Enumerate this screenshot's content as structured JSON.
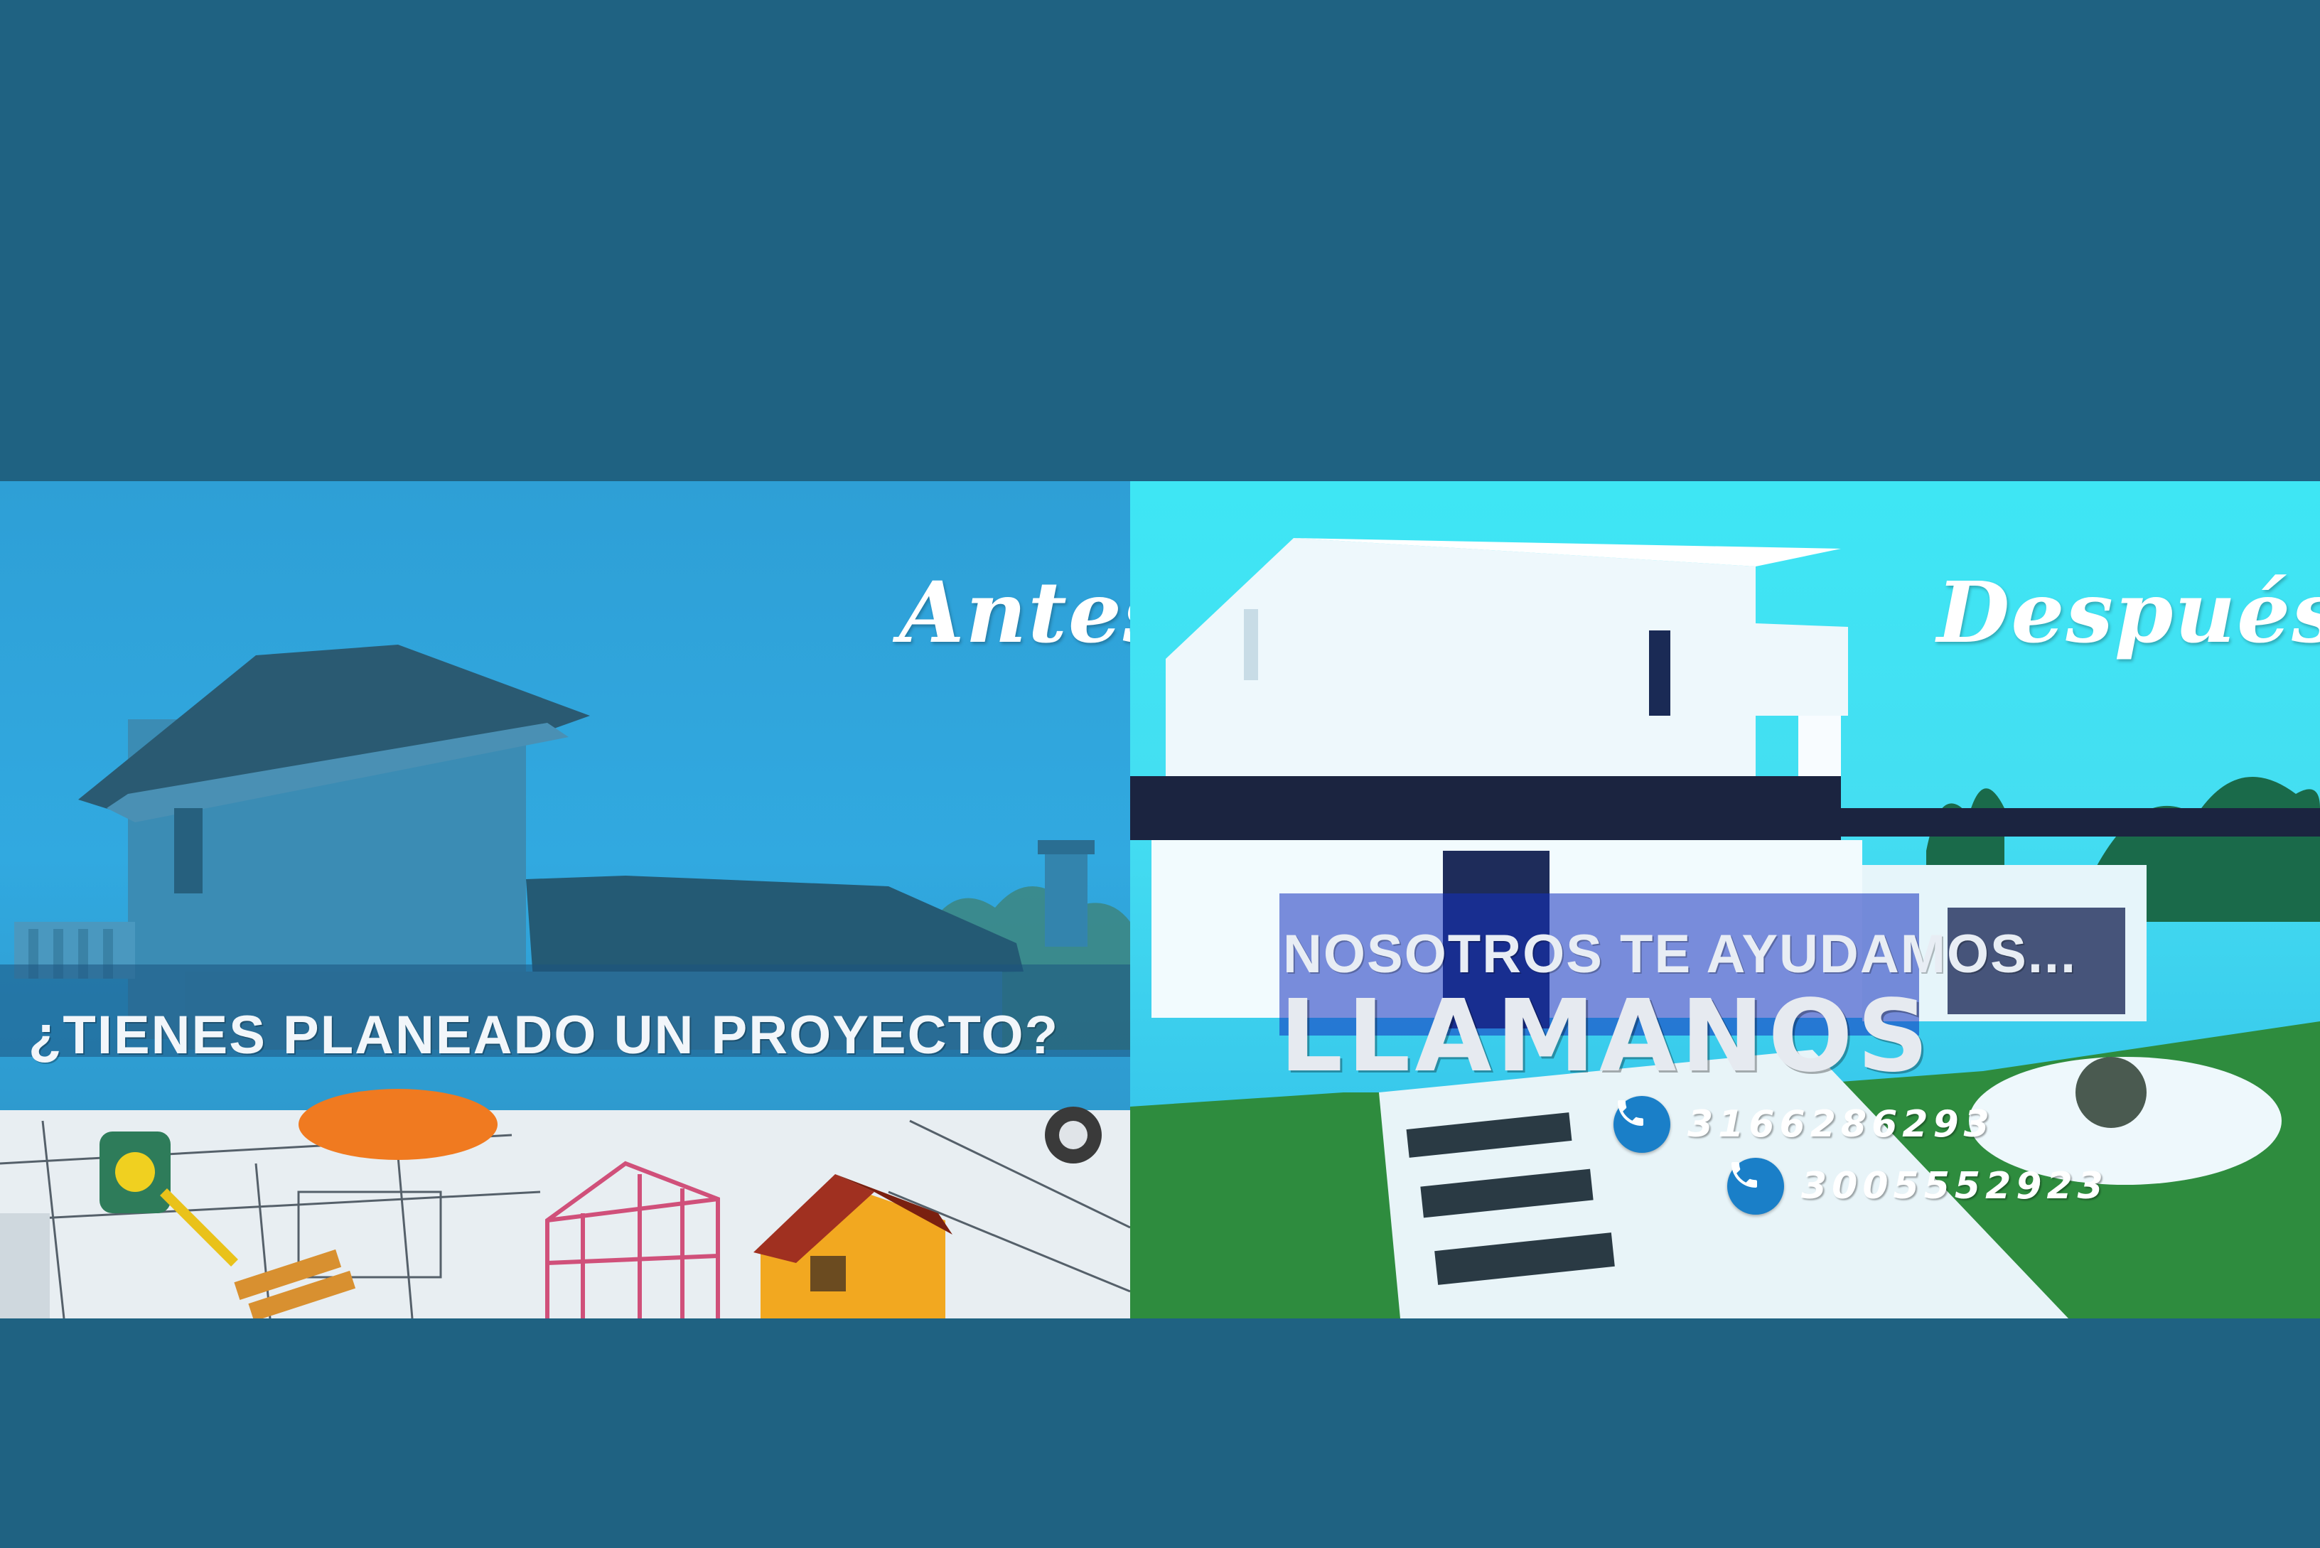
{
  "left_panel": {
    "label": "Antes",
    "question": "¿TIENES PLANEADO UN PROYECTO?"
  },
  "right_panel": {
    "label": "Después",
    "help": "NOSOTROS TE AYUDAMOS...",
    "cta": "LLAMANOS",
    "phones": [
      {
        "number": "3166286293",
        "icon": "phone-icon"
      },
      {
        "number": "3005552923",
        "icon": "phone-icon"
      }
    ]
  },
  "colors": {
    "background": "#1f6282",
    "left_sky": "#31a9e0",
    "right_sky": "#44def2",
    "phone_icon": "#1a7fc8"
  }
}
